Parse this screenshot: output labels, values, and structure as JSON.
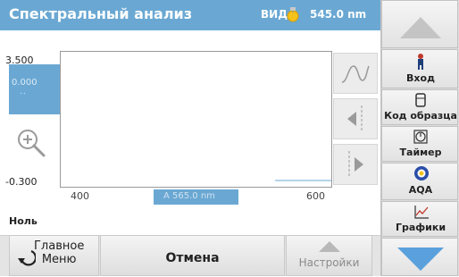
{
  "header": {
    "title": "Спектральный анализ",
    "mode_label": "ВИД",
    "wavelength": "545.0 nm"
  },
  "graph": {
    "y_max": "3.500",
    "y_min": "-0.300",
    "cursor_y_value": "0.000",
    "cursor_y_dots": "..",
    "x_min": "400",
    "x_max": "600",
    "cursor_x_value": "A 565.0 nm"
  },
  "status": "Ноль",
  "bottom": {
    "home_label": "Главное\nМеню",
    "cancel_label": "Отмена",
    "settings_label": "Настройки"
  },
  "sidebar": {
    "items": [
      {
        "label": "Вход",
        "icon": "person-icon"
      },
      {
        "label": "Код образца",
        "icon": "sample-vial-icon"
      },
      {
        "label": "Таймер",
        "icon": "timer-icon"
      },
      {
        "label": "AQA",
        "icon": "aqa-icon"
      },
      {
        "label": "Графики",
        "icon": "graph-icon"
      }
    ]
  },
  "colors": {
    "accent": "#6aa8d3",
    "scroll_arrow": "#5aa0dc"
  }
}
